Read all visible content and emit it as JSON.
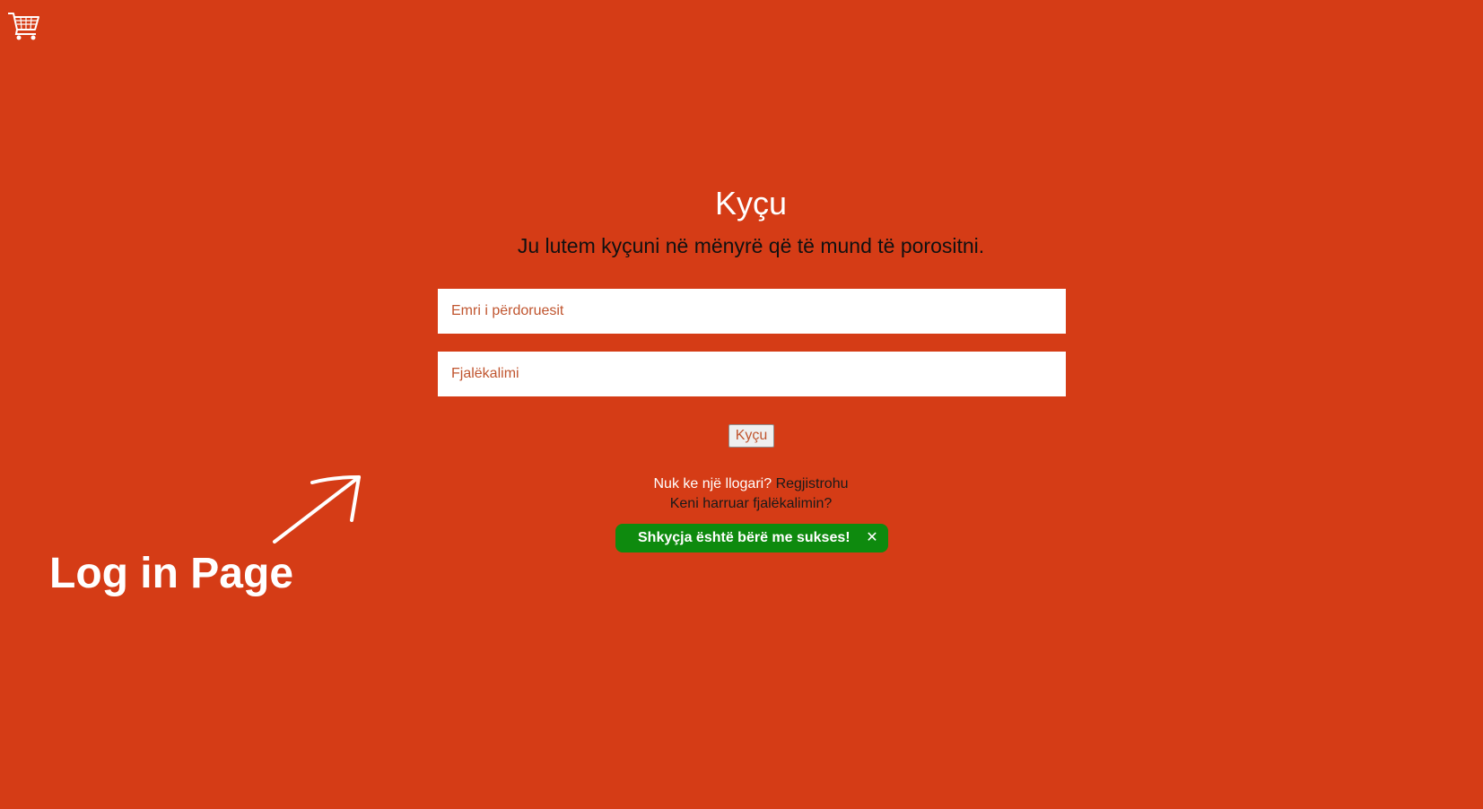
{
  "app": {
    "logo_icon": "shopping-cart-icon"
  },
  "login": {
    "title": "Kyçu",
    "subtitle": "Ju lutem kyçuni në mënyrë që të mund të porositni.",
    "username_placeholder": "Emri i përdoruesit",
    "password_placeholder": "Fjalëkalimi",
    "submit_label": "Kyçu",
    "register_question": "Nuk ke një llogari?",
    "register_link": "Regjistrohu",
    "forgot_password_link": "Keni harruar fjalëkalimin?"
  },
  "notification": {
    "message": "Shkyçja është bërë me sukses!",
    "close_label": "✕",
    "close_icon": "close-icon",
    "color": "#0e8a0e"
  },
  "annotation": {
    "label": "Log in Page",
    "arrow_icon": "arrow-up-right-icon"
  },
  "colors": {
    "background": "#d53c16",
    "input_text": "#c0552f",
    "dark_text": "#1a1a1a"
  }
}
